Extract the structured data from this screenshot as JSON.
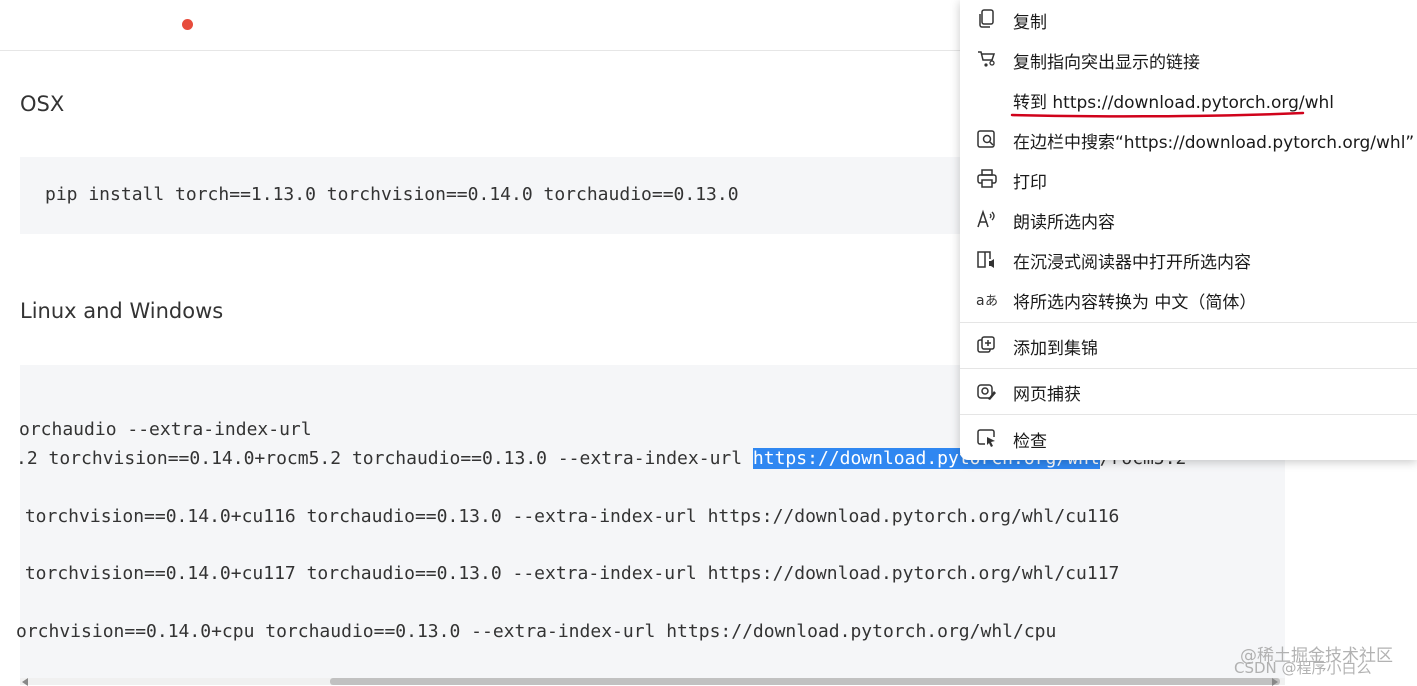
{
  "sections": {
    "osx": {
      "heading": "OSX",
      "code": "pip install torch==1.13.0 torchvision==0.14.0 torchaudio==0.13.0"
    },
    "linux_windows": {
      "heading": "Linux and Windows",
      "lines": [
        "orchaudio --extra-index-url",
        ".2 torchvision==0.14.0+rocm5.2 torchaudio==0.13.0 --extra-index-url ",
        " torchvision==0.14.0+cu116 torchaudio==0.13.0 --extra-index-url https://download.pytorch.org/whl/cu116",
        " torchvision==0.14.0+cu117 torchaudio==0.13.0 --extra-index-url https://download.pytorch.org/whl/cu117",
        "orchvision==0.14.0+cpu torchaudio==0.13.0 --extra-index-url https://download.pytorch.org/whl/cpu"
      ],
      "selected_text": "https://download.pytorch.org/whl",
      "after_selection": "/rocm5.2"
    }
  },
  "context_menu": {
    "items": [
      {
        "label": "复制",
        "icon": "copy-icon"
      },
      {
        "label": "复制指向突出显示的链接",
        "icon": "link-highlight-icon"
      },
      {
        "label": "转到 https://download.pytorch.org/whl",
        "icon": ""
      },
      {
        "label": "在边栏中搜索“https://download.pytorch.org/whl”",
        "icon": "sidebar-search-icon"
      },
      {
        "label": "打印",
        "icon": "printer-icon"
      },
      {
        "label": "朗读所选内容",
        "icon": "read-aloud-icon"
      },
      {
        "label": "在沉浸式阅读器中打开所选内容",
        "icon": "immersive-reader-icon"
      },
      {
        "label": "将所选内容转换为 中文（简体）",
        "icon": "translate-icon"
      },
      {
        "label": "添加到集锦",
        "icon": "collections-icon"
      },
      {
        "label": "网页捕获",
        "icon": "web-capture-icon"
      },
      {
        "label": "检查",
        "icon": "inspect-icon"
      }
    ]
  },
  "watermark": {
    "line1": "@稀土掘金技术社区",
    "line2": "CSDN @程序小白么"
  },
  "colors": {
    "selection": "#2f87f1",
    "annotation_underline": "#d0021b",
    "code_bg": "#f5f6f8"
  }
}
